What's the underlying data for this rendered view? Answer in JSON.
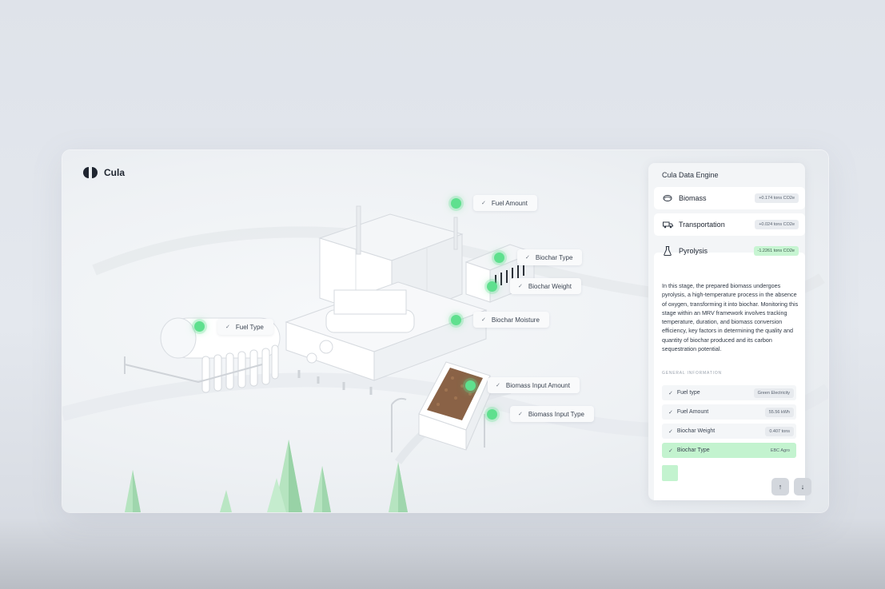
{
  "brand": {
    "name": "Cula",
    "logo_icon": "cula-logo-icon"
  },
  "scene": {
    "tags": [
      {
        "id": "fuel-amount",
        "label": "Fuel Amount"
      },
      {
        "id": "biochar-type",
        "label": "Biochar Type"
      },
      {
        "id": "biochar-weight",
        "label": "Biochar Weight"
      },
      {
        "id": "fuel-type",
        "label": "Fuel Type"
      },
      {
        "id": "biochar-moisture",
        "label": "Biochar Moisture"
      },
      {
        "id": "biomass-input-amount",
        "label": "Biomass Input Amount"
      },
      {
        "id": "biomass-input-type",
        "label": "Biomass Input Type"
      }
    ],
    "hotspot_color": "#5fe08e"
  },
  "panel": {
    "title": "Cula Data Engine",
    "stages": [
      {
        "name": "Biomass",
        "icon": "leaf-icon",
        "value": "+0.174 tons CO2e"
      },
      {
        "name": "Transportation",
        "icon": "truck-icon",
        "value": "+0.024 tons CO2e"
      },
      {
        "name": "Pyrolysis",
        "icon": "flask-icon",
        "value": "-1.2261 tons CO2e",
        "expanded": true
      }
    ],
    "description": "In this stage, the prepared biomass undergoes pyrolysis, a high-temperature process in the absence of oxygen, transforming it into biochar. Monitoring this stage within an MRV framework involves tracking temperature, duration, and biomass conversion efficiency, key factors in determining the quality and quantity of biochar produced and its carbon sequestration potential.",
    "general_information_label": "GENERAL INFORMATION",
    "info_rows": [
      {
        "label": "Fuel type",
        "value": "Green Electricity"
      },
      {
        "label": "Fuel Amount",
        "value": "55.56 kWh"
      },
      {
        "label": "Biochar Weight",
        "value": "0.407 tons"
      },
      {
        "label": "Biochar Type",
        "value": "EBC Agro",
        "active": true
      }
    ],
    "nav": {
      "up_icon": "arrow-up-icon",
      "down_icon": "arrow-down-icon",
      "up": "↑",
      "down": "↓"
    },
    "accent_green": "#c3f3cf"
  }
}
